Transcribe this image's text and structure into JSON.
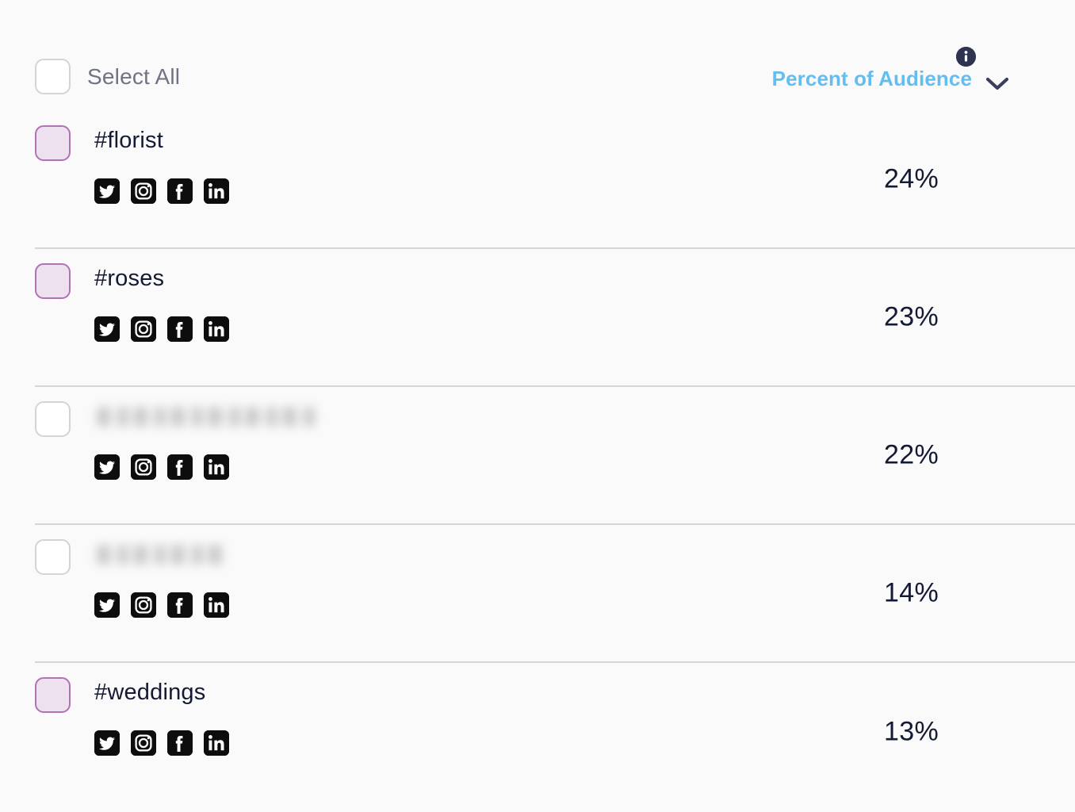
{
  "header": {
    "select_all_label": "Select All",
    "select_all_checked": false,
    "metric_label": "Percent of Audience",
    "info_icon": "info-icon",
    "chevron_icon": "chevron-down-icon"
  },
  "colors": {
    "background": "#fafafa",
    "metric_accent": "#64bdf0",
    "text_primary": "#141a33",
    "text_muted": "#6f7383",
    "checkbox_selected_fill": "#eee1ef",
    "checkbox_selected_border": "#b172b4",
    "checkbox_border": "#d4d4d6",
    "divider": "#d6d6d8",
    "info_badge": "#2f3350",
    "social_icon_bg": "#0d0d0d"
  },
  "social_networks": [
    {
      "name": "twitter-icon",
      "label": "Twitter"
    },
    {
      "name": "instagram-icon",
      "label": "Instagram"
    },
    {
      "name": "facebook-icon",
      "label": "Facebook"
    },
    {
      "name": "linkedin-icon",
      "label": "LinkedIn"
    }
  ],
  "rows": [
    {
      "tag": "#florist",
      "percent": "24%",
      "selected": true,
      "redacted": false,
      "blur_width": 0
    },
    {
      "tag": "#roses",
      "percent": "23%",
      "selected": true,
      "redacted": false,
      "blur_width": 0
    },
    {
      "tag": "",
      "percent": "22%",
      "selected": false,
      "redacted": true,
      "blur_width": 278
    },
    {
      "tag": "",
      "percent": "14%",
      "selected": false,
      "redacted": true,
      "blur_width": 166
    },
    {
      "tag": "#weddings",
      "percent": "13%",
      "selected": true,
      "redacted": false,
      "blur_width": 0
    }
  ]
}
